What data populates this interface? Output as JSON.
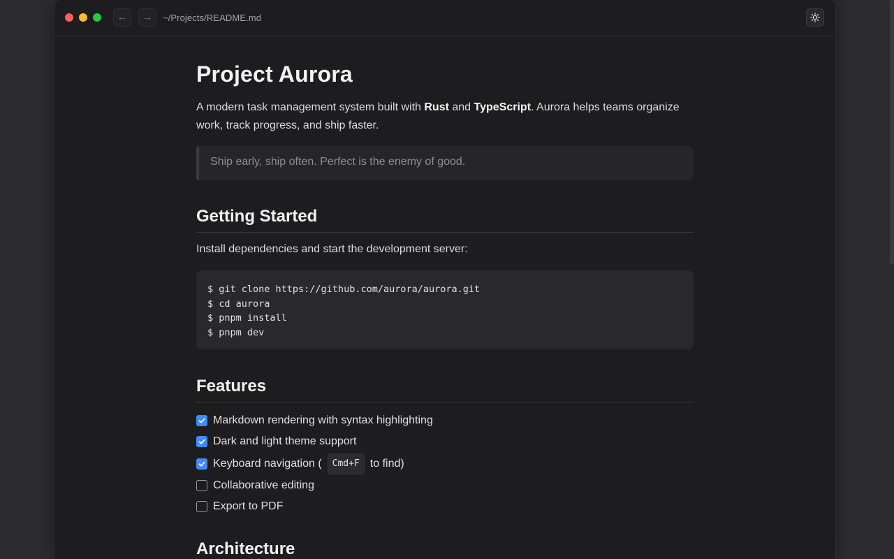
{
  "window": {
    "path": "~/Projects/README.md",
    "back_glyph": "←",
    "forward_glyph": "→"
  },
  "doc": {
    "title": "Project Aurora",
    "intro": {
      "before": "A modern task management system built with ",
      "bold1": "Rust",
      "middle": " and ",
      "bold2": "TypeScript",
      "after": ". Aurora helps teams organize work, track progress, and ship faster."
    },
    "quote": "Ship early, ship often. Perfect is the enemy of good.",
    "getting_started": {
      "heading": "Getting Started",
      "paragraph": "Install dependencies and start the development server:",
      "code_lines": [
        "$ git clone https://github.com/aurora/aurora.git",
        "$ cd aurora",
        "$ pnpm install",
        "$ pnpm dev"
      ]
    },
    "features": {
      "heading": "Features",
      "items": [
        {
          "label": "Markdown rendering with syntax highlighting",
          "checked": true
        },
        {
          "label": "Dark and light theme support",
          "checked": true
        },
        {
          "label_before": "Keyboard navigation (",
          "kbd": "Cmd+F",
          "label_after": "to find)",
          "checked": true
        },
        {
          "label": "Collaborative editing",
          "checked": false
        },
        {
          "label": "Export to PDF",
          "checked": false
        }
      ]
    },
    "architecture": {
      "heading": "Architecture"
    }
  },
  "colors": {
    "accent": "#3d8bfd",
    "background": "#1d1d1f"
  },
  "icons": {
    "theme_toggle": "sun-icon",
    "checkbox": "check-icon"
  }
}
